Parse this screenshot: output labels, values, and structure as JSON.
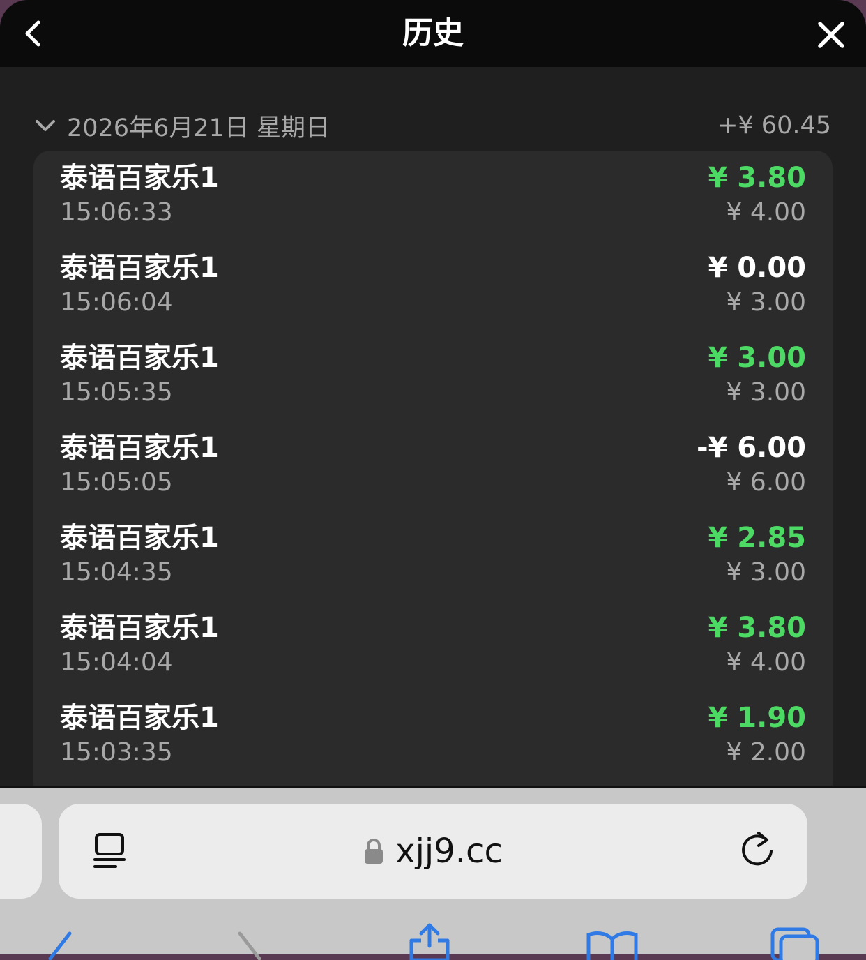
{
  "header": {
    "title": "历史",
    "back_icon": "chevron-left-icon",
    "close_icon": "close-icon"
  },
  "day": {
    "date": "2026年6月21日 星期日",
    "total": "+¥ 60.45",
    "toggle_icon": "chevron-down-icon"
  },
  "records": [
    {
      "name": "泰语百家乐1",
      "time": "15:06:33",
      "amount": "¥ 3.80",
      "bet": "¥ 4.00",
      "color": "#4cd964"
    },
    {
      "name": "泰语百家乐1",
      "time": "15:06:04",
      "amount": "¥ 0.00",
      "bet": "¥ 3.00",
      "color": "#ffffff"
    },
    {
      "name": "泰语百家乐1",
      "time": "15:05:35",
      "amount": "¥ 3.00",
      "bet": "¥ 3.00",
      "color": "#4cd964"
    },
    {
      "name": "泰语百家乐1",
      "time": "15:05:05",
      "amount": "-¥ 6.00",
      "bet": "¥ 6.00",
      "color": "#ffffff"
    },
    {
      "name": "泰语百家乐1",
      "time": "15:04:35",
      "amount": "¥ 2.85",
      "bet": "¥ 3.00",
      "color": "#4cd964"
    },
    {
      "name": "泰语百家乐1",
      "time": "15:04:04",
      "amount": "¥ 3.80",
      "bet": "¥ 4.00",
      "color": "#4cd964"
    },
    {
      "name": "泰语百家乐1",
      "time": "15:03:35",
      "amount": "¥ 1.90",
      "bet": "¥ 2.00",
      "color": "#4cd964"
    }
  ],
  "browser": {
    "url": "xjj9.cc",
    "reader_icon": "reader-mode-icon",
    "lock_icon": "lock-icon",
    "reload_icon": "reload-icon",
    "toolbar_icons": [
      "back-arrow-icon",
      "forward-arrow-icon",
      "share-icon",
      "bookmarks-icon",
      "tabs-icon"
    ]
  },
  "colors": {
    "win": "#4cd964",
    "header_bg": "#0b0b0b",
    "modal_bg": "#1f1f1f",
    "card_bg": "#2b2b2b"
  }
}
